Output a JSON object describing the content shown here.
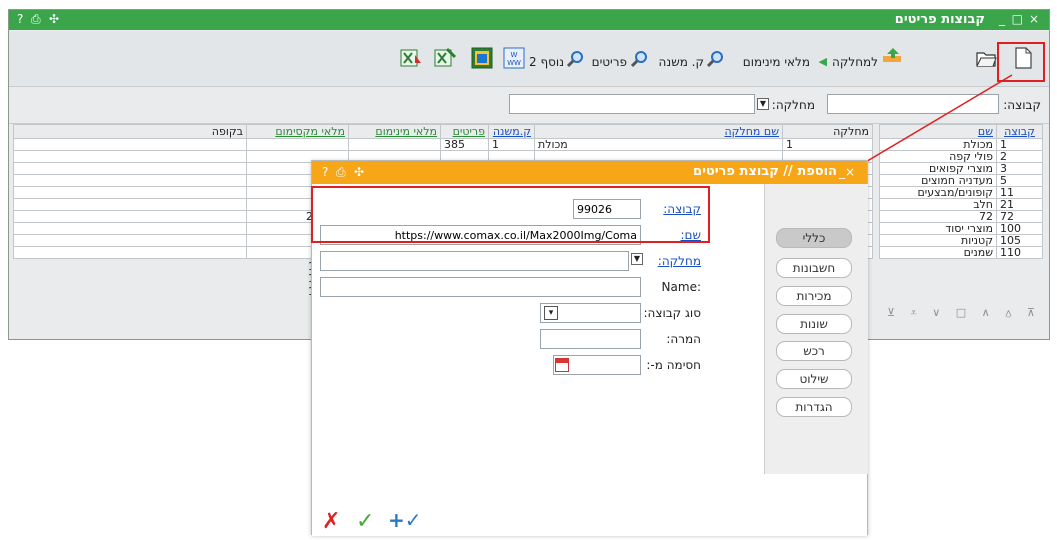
{
  "window": {
    "title": "קבוצות פריטים",
    "controls": [
      "×",
      "□",
      "_"
    ],
    "left_icons": [
      "?",
      "⎙",
      "✣"
    ]
  },
  "toolbar": {
    "new_icon": "new-document-icon",
    "open_icon": "open-folder-icon",
    "to_department": "למחלקה",
    "min_stock": "מלאי מינימום",
    "sub_group": "ק. משנה",
    "items": "פריטים",
    "extra2": "נוסף 2"
  },
  "filter": {
    "group_label": "קבוצה:",
    "department_label": "מחלקה:"
  },
  "left_table": {
    "headers": [
      "קבוצה",
      "שם"
    ],
    "rows": [
      [
        "1",
        "מכולת"
      ],
      [
        "2",
        "פולי קפה"
      ],
      [
        "3",
        "מוצרי קפואים"
      ],
      [
        "5",
        "מעדניה חמוצים"
      ],
      [
        "11",
        "קופונים/מבצעים"
      ],
      [
        "21",
        "חלב"
      ],
      [
        "72",
        "72"
      ],
      [
        "100",
        "מוצרי יסוד"
      ],
      [
        "105",
        "קטניות"
      ],
      [
        "110",
        "שמנים"
      ]
    ]
  },
  "right_table": {
    "headers": [
      "מחלקה",
      "שם מחלקה",
      "ק.משנה",
      "פריטים",
      "מלאי מינימום",
      "מלאי מקסימום",
      "בקופה"
    ],
    "first_row": {
      "department": "1",
      "department_name": "מכולת",
      "sub_group": "1",
      "items": "385"
    },
    "partial_values": [
      "2",
      "1",
      "1",
      "1"
    ]
  },
  "modal": {
    "title": "הוספת // קבוצת פריטים",
    "controls": [
      "×",
      "_"
    ],
    "left_icons": [
      "?",
      "⎙",
      "✣"
    ],
    "fields": {
      "group_label": "קבוצה:",
      "group_value": "99026",
      "name_label": "שם:",
      "name_value": "https://www.comax.co.il/Max2000Img/Coma",
      "department_label": "מחלקה:",
      "name_en_label": ":Name",
      "group_type_label": "סוג קבוצה:",
      "conversion_label": "המרה:",
      "block_label": "חסימה מ-:"
    },
    "tabs": [
      "כללי",
      "חשבונות",
      "מכירות",
      "שונות",
      "רכש",
      "שילוט",
      "הגדרות"
    ],
    "footer": {
      "cancel": "✗",
      "ok": "✓",
      "ok_plus": "+✓"
    }
  },
  "colors": {
    "main_title_bar": "#3aa54a",
    "modal_title_bar": "#f6a616",
    "highlight": "#e02020"
  }
}
